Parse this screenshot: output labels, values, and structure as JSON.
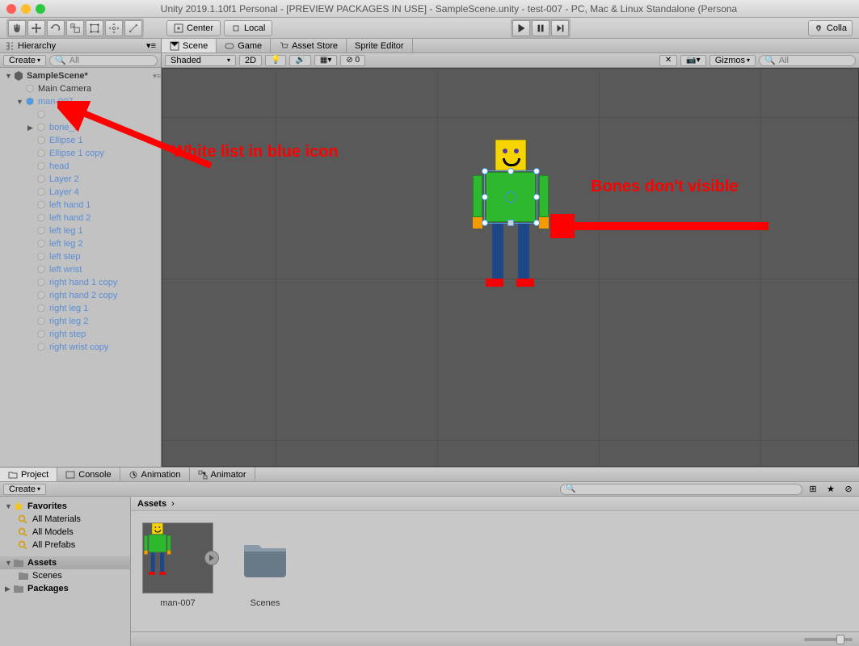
{
  "window": {
    "title": "Unity 2019.1.10f1 Personal - [PREVIEW PACKAGES IN USE] - SampleScene.unity - test-007 - PC, Mac & Linux Standalone (Persona"
  },
  "toolbar": {
    "center": "Center",
    "local": "Local",
    "collab": "Colla"
  },
  "hierarchy": {
    "tab": "Hierarchy",
    "create": "Create",
    "search_placeholder": "All",
    "scene": "SampleScene*",
    "items": [
      {
        "label": "Main Camera",
        "depth": 1,
        "color": "black"
      },
      {
        "label": "man-007",
        "depth": 1,
        "color": "blue",
        "arrow": "▼",
        "blueicon": true
      },
      {
        "label": "",
        "depth": 2,
        "color": "blue"
      },
      {
        "label": "bone_1",
        "depth": 2,
        "color": "blue",
        "arrow": "▶"
      },
      {
        "label": "Ellipse 1",
        "depth": 2,
        "color": "blue"
      },
      {
        "label": "Ellipse 1 copy",
        "depth": 2,
        "color": "blue"
      },
      {
        "label": "head",
        "depth": 2,
        "color": "blue"
      },
      {
        "label": "Layer 2",
        "depth": 2,
        "color": "blue"
      },
      {
        "label": "Layer 4",
        "depth": 2,
        "color": "blue"
      },
      {
        "label": "left hand 1",
        "depth": 2,
        "color": "blue"
      },
      {
        "label": "left hand 2",
        "depth": 2,
        "color": "blue"
      },
      {
        "label": "left leg 1",
        "depth": 2,
        "color": "blue"
      },
      {
        "label": "left leg 2",
        "depth": 2,
        "color": "blue"
      },
      {
        "label": "left step",
        "depth": 2,
        "color": "blue"
      },
      {
        "label": "left wrist",
        "depth": 2,
        "color": "blue"
      },
      {
        "label": "right hand 1 copy",
        "depth": 2,
        "color": "blue"
      },
      {
        "label": "right hand 2 copy",
        "depth": 2,
        "color": "blue"
      },
      {
        "label": "right leg 1",
        "depth": 2,
        "color": "blue"
      },
      {
        "label": "right leg 2",
        "depth": 2,
        "color": "blue"
      },
      {
        "label": "right step",
        "depth": 2,
        "color": "blue"
      },
      {
        "label": "right wrist copy",
        "depth": 2,
        "color": "blue"
      }
    ]
  },
  "scene": {
    "tabs": {
      "scene": "Scene",
      "game": "Game",
      "asset_store": "Asset Store",
      "sprite_editor": "Sprite Editor"
    },
    "shaded": "Shaded",
    "mode_2d": "2D",
    "gizmos": "Gizmos",
    "search_placeholder": "All"
  },
  "annotations": {
    "left": "White list in blue icon",
    "right": "Bones don't visible"
  },
  "project": {
    "tabs": {
      "project": "Project",
      "console": "Console",
      "animation": "Animation",
      "animator": "Animator"
    },
    "create": "Create",
    "favorites": "Favorites",
    "fav_items": [
      "All Materials",
      "All Models",
      "All Prefabs"
    ],
    "assets": "Assets",
    "assets_items": [
      "Scenes"
    ],
    "packages": "Packages",
    "breadcrumb": "Assets",
    "thumbs": {
      "man": "man-007",
      "scenes": "Scenes"
    }
  }
}
